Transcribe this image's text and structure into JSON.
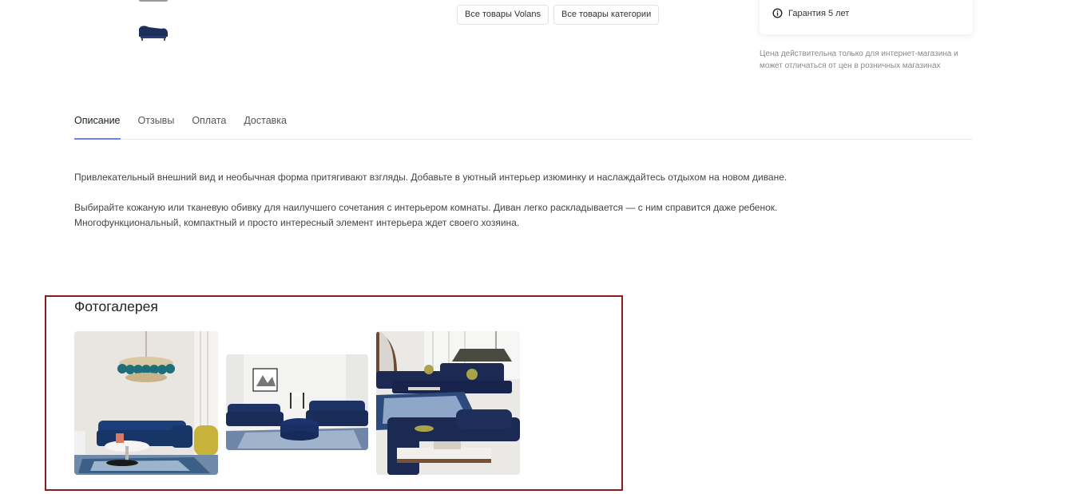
{
  "tags": {
    "brand_label": "Все товары Volans",
    "category_label": "Все товары категории"
  },
  "side": {
    "warranty_label": "Гарантия 5 лет",
    "price_note": "Цена действительна только для интернет-магазина и может отличаться от цен в розничных магазинах"
  },
  "tabs": [
    {
      "label": "Описание",
      "active": true
    },
    {
      "label": "Отзывы",
      "active": false
    },
    {
      "label": "Оплата",
      "active": false
    },
    {
      "label": "Доставка",
      "active": false
    }
  ],
  "description": {
    "paragraph_1": "Привлекательный внешний вид и необычная форма притягивают взгляды. Добавьте в уютный интерьер изюминку и наслаждайтесь отдыхом на новом диване.",
    "paragraph_2": "Выбирайте кожаную или тканевую обивку для наилучшего сочетания с интерьером комнаты. Диван легко раскладывается — с ним справится даже ребенок. Многофункциональный, компактный и просто интересный элемент интерьера ждет своего хозяина."
  },
  "gallery": {
    "title": "Фотогалерея"
  },
  "colors": {
    "tab_accent": "#6f7ff0",
    "gallery_highlight": "#8b1a1a",
    "sofa_blue": "#1e2f5c"
  }
}
